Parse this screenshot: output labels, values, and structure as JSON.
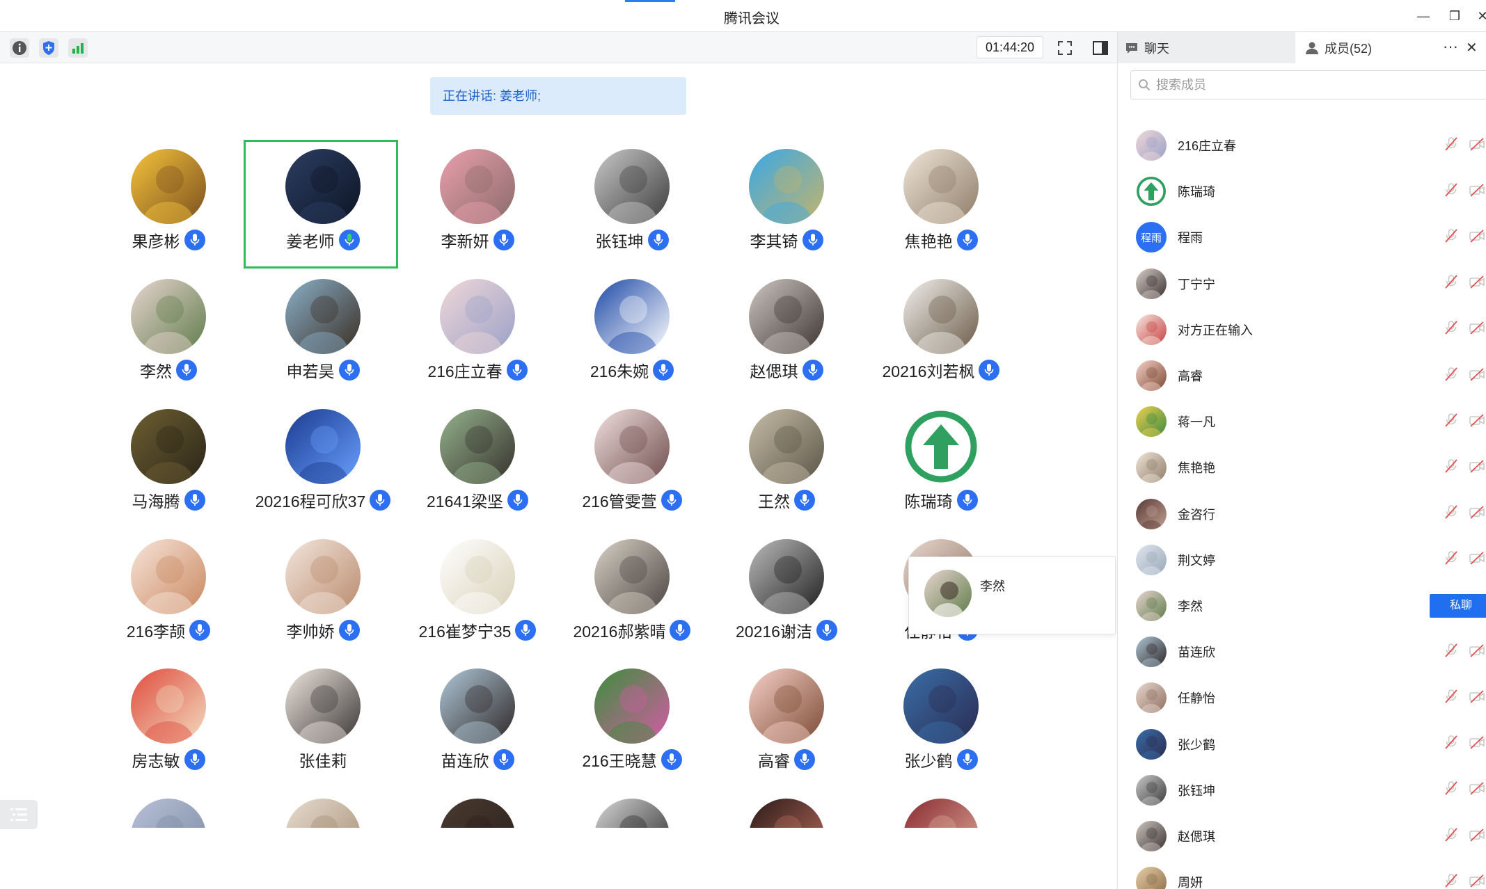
{
  "window": {
    "title": "腾讯会议"
  },
  "toolbar": {
    "timer": "01:44:20"
  },
  "speaking": {
    "label": "正在讲话: 姜老师;"
  },
  "grid": [
    {
      "name": "果彦彬",
      "colors": [
        "#f5c33b",
        "#7a4f1f"
      ]
    },
    {
      "name": "姜老师",
      "colors": [
        "#2c3e63",
        "#0d1524"
      ],
      "active": true,
      "green_mic": true
    },
    {
      "name": "李新妍",
      "colors": [
        "#e9a0ad",
        "#8a6a6a"
      ]
    },
    {
      "name": "张钰坤",
      "colors": [
        "#c9c9c9",
        "#3b3b3b"
      ]
    },
    {
      "name": "李其锜",
      "colors": [
        "#38a8e8",
        "#c5b46a"
      ]
    },
    {
      "name": "焦艳艳",
      "colors": [
        "#efe6d8",
        "#8e7b68"
      ]
    },
    {
      "name": "李然",
      "colors": [
        "#e8d5d0",
        "#5e7c4a"
      ]
    },
    {
      "name": "申若昊",
      "colors": [
        "#8ab0c9",
        "#3a2d22"
      ]
    },
    {
      "name": "216庄立春",
      "colors": [
        "#f0d8d8",
        "#9aa0c8"
      ]
    },
    {
      "name": "216朱婉",
      "colors": [
        "#1f4aa8",
        "#ffffff"
      ]
    },
    {
      "name": "赵偲琪",
      "colors": [
        "#cfc6c1",
        "#3a3330"
      ]
    },
    {
      "name": "20216刘若枫",
      "colors": [
        "#f2f0ec",
        "#6a5a48"
      ]
    },
    {
      "name": "马海腾",
      "colors": [
        "#6e6032",
        "#2a2418"
      ]
    },
    {
      "name": "20216程可欣37",
      "colors": [
        "#1a3b8f",
        "#6aa0ff"
      ]
    },
    {
      "name": "21641梁坚",
      "colors": [
        "#95b38d",
        "#35302c"
      ]
    },
    {
      "name": "216管雯萱",
      "colors": [
        "#f1e1df",
        "#6d4a4a"
      ]
    },
    {
      "name": "王然",
      "colors": [
        "#c7bda8",
        "#5a5446"
      ]
    },
    {
      "name": "陈瑞琦",
      "colors": [
        "#ffffff",
        "#2fa060"
      ],
      "arrow": true
    },
    {
      "name": "216李颉",
      "colors": [
        "#f7e5da",
        "#c9875f"
      ]
    },
    {
      "name": "李帅娇",
      "colors": [
        "#f3e6dd",
        "#b98a6c"
      ]
    },
    {
      "name": "216崔梦宁35",
      "colors": [
        "#ffffff",
        "#d8d0b8"
      ]
    },
    {
      "name": "20216郝紫晴",
      "colors": [
        "#d9d2c6",
        "#4a4240"
      ]
    },
    {
      "name": "20216谢洁",
      "colors": [
        "#bcbcbc",
        "#1e1e1e"
      ]
    },
    {
      "name": "任静怡",
      "colors": [
        "#e8d8d0",
        "#8f6f5f"
      ]
    },
    {
      "name": "房志敏",
      "colors": [
        "#e04c3e",
        "#f2dcc0"
      ]
    },
    {
      "name": "张佳莉",
      "colors": [
        "#efe7df",
        "#3a3636"
      ],
      "no_mic": true
    },
    {
      "name": "苗连欣",
      "colors": [
        "#b0c8d8",
        "#2d2626"
      ]
    },
    {
      "name": "216王晓慧",
      "colors": [
        "#3b8f3a",
        "#d65aa8"
      ]
    },
    {
      "name": "高睿",
      "colors": [
        "#f7d0c8",
        "#7a4a33"
      ]
    },
    {
      "name": "张少鹤",
      "colors": [
        "#3a6fa8",
        "#2a2a50"
      ]
    },
    {
      "name": "",
      "colors": [
        "#b8c0d8",
        "#7a8aa0"
      ]
    },
    {
      "name": "",
      "colors": [
        "#e8ddd0",
        "#a08a70"
      ]
    },
    {
      "name": "",
      "colors": [
        "#4a3a30",
        "#2a201a"
      ]
    },
    {
      "name": "",
      "colors": [
        "#d8d8d8",
        "#1e1e1e"
      ]
    },
    {
      "name": "",
      "colors": [
        "#2a1a18",
        "#c07060"
      ]
    },
    {
      "name": "",
      "colors": [
        "#8a2a30",
        "#e0b0a0"
      ]
    }
  ],
  "popup": {
    "name": "李然"
  },
  "panel": {
    "tab_chat": "聊天",
    "tab_members": "成员(52)",
    "search_placeholder": "搜索成员",
    "dm_label": "私聊",
    "members": [
      {
        "name": "216庄立春",
        "colors": [
          "#f0d8d8",
          "#9aa0c8"
        ]
      },
      {
        "name": "陈瑞琦",
        "colors": [
          "#ffffff",
          "#2fa060"
        ],
        "arrow": true
      },
      {
        "name": "程雨",
        "text_avatar": "程雨"
      },
      {
        "name": "丁宁宁",
        "colors": [
          "#d8cfc8",
          "#3a3030"
        ]
      },
      {
        "name": "对方正在输入",
        "colors": [
          "#f5e8e0",
          "#c84040"
        ]
      },
      {
        "name": "高睿",
        "colors": [
          "#f7d0c8",
          "#7a4a33"
        ]
      },
      {
        "name": "蒋一凡",
        "colors": [
          "#f0d050",
          "#3a8a40"
        ]
      },
      {
        "name": "焦艳艳",
        "colors": [
          "#efe6d8",
          "#8e7b68"
        ]
      },
      {
        "name": "金咨行",
        "colors": [
          "#5a3a38",
          "#c0a090"
        ]
      },
      {
        "name": "荆文婷",
        "colors": [
          "#dfe6ee",
          "#9aa8b8"
        ]
      },
      {
        "name": "李然",
        "colors": [
          "#e8d5d0",
          "#5e7c4a"
        ],
        "dm": true
      },
      {
        "name": "苗连欣",
        "colors": [
          "#b0c8d8",
          "#2d2626"
        ]
      },
      {
        "name": "任静怡",
        "colors": [
          "#e8d8d0",
          "#8f6f5f"
        ]
      },
      {
        "name": "张少鹤",
        "colors": [
          "#3a6fa8",
          "#2a2a50"
        ]
      },
      {
        "name": "张钰坤",
        "colors": [
          "#c9c9c9",
          "#3b3b3b"
        ]
      },
      {
        "name": "赵偲琪",
        "colors": [
          "#cfc6c1",
          "#3a3330"
        ]
      },
      {
        "name": "周妍",
        "colors": [
          "#e6cfa8",
          "#8a6a48"
        ]
      }
    ]
  }
}
